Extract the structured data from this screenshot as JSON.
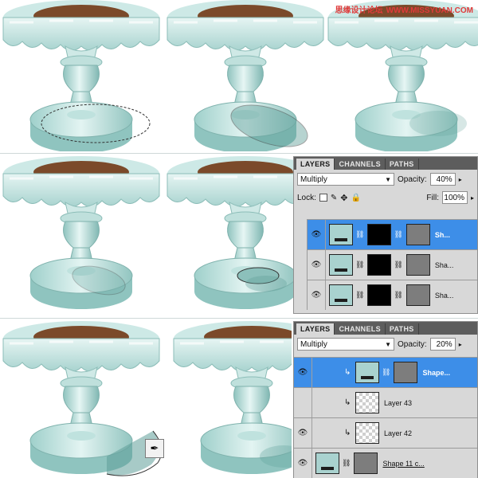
{
  "watermark": {
    "cn": "思缘设计论坛",
    "url": "WWW.MISSYUAN.COM"
  },
  "panel_top": {
    "tabs": [
      "LAYERS",
      "CHANNELS",
      "PATHS"
    ],
    "blend_mode": "Multiply",
    "opacity_label": "Opacity:",
    "opacity": "40%",
    "lock_label": "Lock:",
    "fill_label": "Fill:",
    "fill": "100%",
    "layers": [
      {
        "name": "Sh...",
        "selected": true
      },
      {
        "name": "Sha...",
        "selected": false
      },
      {
        "name": "Sha...",
        "selected": false
      }
    ]
  },
  "panel_bottom": {
    "tabs": [
      "LAYERS",
      "CHANNELS",
      "PATHS"
    ],
    "blend_mode": "Multiply",
    "opacity_label": "Opacity:",
    "opacity": "20%",
    "layers": [
      {
        "name": "Shape...",
        "selected": true
      },
      {
        "name": "Layer 43",
        "selected": false
      },
      {
        "name": "Layer 42",
        "selected": false
      },
      {
        "name": "Shape 11 c...",
        "selected": false
      }
    ]
  },
  "icons": {
    "eye": "eye-icon",
    "chain": "link-icon",
    "clip": "clipping-arrow-icon",
    "cursor": "pen-cursor-icon"
  },
  "colors": {
    "stand_light": "#d8efec",
    "stand_mid": "#a9d4d0",
    "stand_dark": "#6fa9a4",
    "chocolate": "#7b4a2a",
    "panel_selected": "#3d8ee8",
    "tabs_bar": "#5d5d5d",
    "watermark": "#e03a3a"
  }
}
